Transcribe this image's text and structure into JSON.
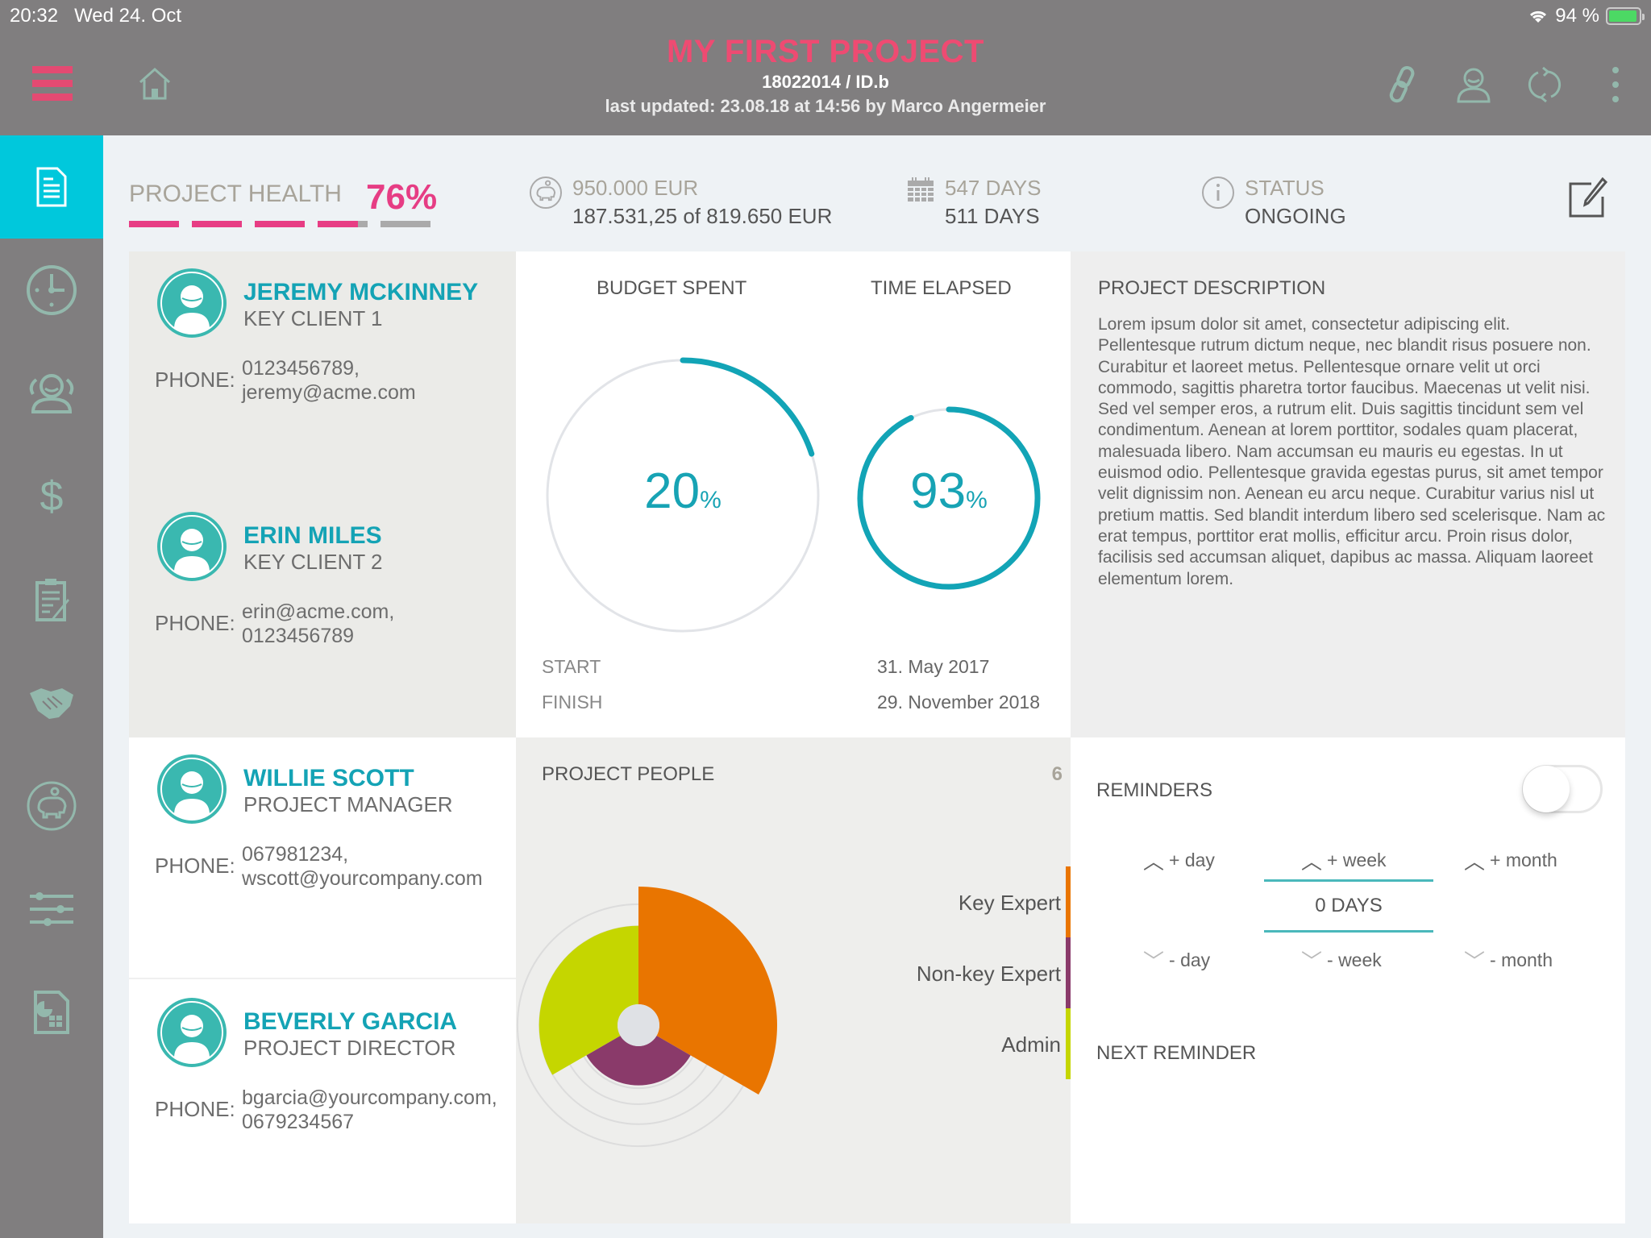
{
  "status_bar": {
    "time": "20:32",
    "date": "Wed 24. Oct",
    "battery": "94 %",
    "battery_level": 0.94
  },
  "header": {
    "title": "MY FIRST PROJECT",
    "project_id": "18022014 / ID.b",
    "last_updated": "last updated: 23.08.18 at 14:56 by Marco Angermeier",
    "icons": [
      "menu-icon",
      "home-icon",
      "link-icon",
      "user-icon",
      "sync-icon",
      "more-vertical-icon"
    ]
  },
  "sidebar": {
    "items": [
      {
        "name": "overview",
        "icon": "document-icon",
        "active": true
      },
      {
        "name": "time",
        "icon": "clock-icon",
        "active": false
      },
      {
        "name": "people",
        "icon": "people-icon",
        "active": false
      },
      {
        "name": "finance",
        "icon": "dollar-icon",
        "active": false
      },
      {
        "name": "tasks",
        "icon": "clipboard-icon",
        "active": false
      },
      {
        "name": "partners",
        "icon": "handshake-icon",
        "active": false
      },
      {
        "name": "budget",
        "icon": "piggy-bank-icon",
        "active": false
      },
      {
        "name": "settings",
        "icon": "sliders-icon",
        "active": false
      },
      {
        "name": "reports",
        "icon": "report-icon",
        "active": false
      }
    ]
  },
  "summary": {
    "health_label": "PROJECT HEALTH",
    "health_value": "76%",
    "health_fraction": 0.76,
    "budget_total": "950.000 EUR",
    "budget_spent": "187.531,25 of 819.650 EUR",
    "days_total": "547 DAYS",
    "days_elapsed": "511 DAYS",
    "status_label": "STATUS",
    "status_value": "ONGOING"
  },
  "contacts": [
    {
      "name": "JEREMY MCKINNEY",
      "role": "KEY CLIENT 1",
      "label": "PHONE:",
      "line1": "0123456789,",
      "line2": "jeremy@acme.com"
    },
    {
      "name": "ERIN MILES",
      "role": "KEY CLIENT 2",
      "label": "PHONE:",
      "line1": "erin@acme.com,",
      "line2": "0123456789"
    },
    {
      "name": "WILLIE SCOTT",
      "role": "PROJECT MANAGER",
      "label": "PHONE:",
      "line1": "067981234,",
      "line2": "wscott@yourcompany.com"
    },
    {
      "name": "BEVERLY GARCIA",
      "role": "PROJECT DIRECTOR",
      "label": "PHONE:",
      "line1": "bgarcia@yourcompany.com,",
      "line2": "0679234567"
    }
  ],
  "gauges": {
    "budget": {
      "label": "BUDGET SPENT",
      "value": "20",
      "unit": "%",
      "fraction": 0.2
    },
    "time": {
      "label": "TIME ELAPSED",
      "value": "93",
      "unit": "%",
      "fraction": 0.93
    },
    "start_label": "START",
    "start_value": "31. May 2017",
    "finish_label": "FINISH",
    "finish_value": "29. November 2018"
  },
  "description": {
    "title": "PROJECT DESCRIPTION",
    "text": "Lorem ipsum dolor sit amet, consectetur adipiscing elit. Pellentesque rutrum dictum neque, nec blandit risus posuere non. Curabitur et laoreet metus. Pellentesque ornare velit ut orci commodo, sagittis pharetra tortor faucibus. Maecenas ut velit nisi. Sed vel semper eros, a rutrum elit. Duis sagittis tincidunt sem vel condimentum. Aenean at lorem porttitor, sodales quam placerat, malesuada libero. Nam accumsan eu mauris eu egestas. In ut euismod odio. Pellentesque gravida egestas purus, sit amet tempor velit dignissim non. Aenean eu arcu neque. Curabitur varius nisl ut pretium mattis. Sed blandit interdum libero sed scelerisque. Nam ac erat tempus, porttitor erat mollis, efficitur arcu. Proin risus dolor, facilisis sed accumsan aliquet, dapibus ac massa. Aliquam laoreet elementum lorem."
  },
  "people": {
    "title": "PROJECT PEOPLE",
    "count": "6"
  },
  "chart_data": {
    "type": "polar-area",
    "title": "PROJECT PEOPLE",
    "total": 6,
    "categories": [
      "Key Expert",
      "Non-key Expert",
      "Admin"
    ],
    "values": [
      3,
      1,
      2
    ],
    "colors": [
      "#e97500",
      "#8a3a6a",
      "#c5d600"
    ],
    "legend": "right"
  },
  "reminders": {
    "title": "REMINDERS",
    "enabled": false,
    "plus_day": "+ day",
    "plus_week": "+ week",
    "plus_month": "+ month",
    "minus_day": "- day",
    "minus_week": "- week",
    "minus_month": "- month",
    "value": "0 DAYS",
    "next_label": "NEXT REMINDER"
  }
}
